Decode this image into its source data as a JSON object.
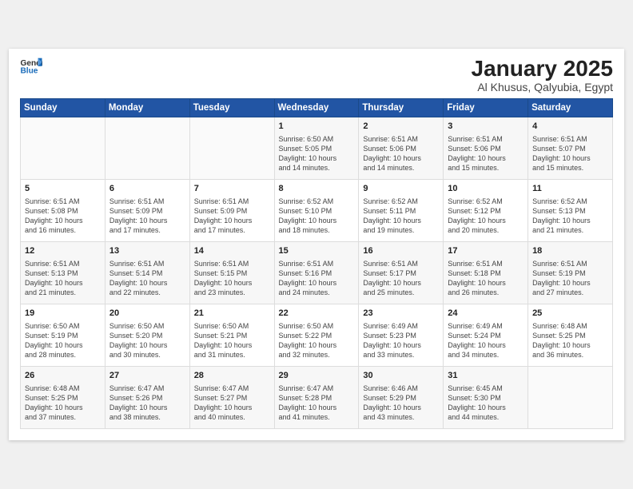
{
  "header": {
    "logo_general": "General",
    "logo_blue": "Blue",
    "month": "January 2025",
    "location": "Al Khusus, Qalyubia, Egypt"
  },
  "weekdays": [
    "Sunday",
    "Monday",
    "Tuesday",
    "Wednesday",
    "Thursday",
    "Friday",
    "Saturday"
  ],
  "rows": [
    [
      {
        "day": "",
        "info": ""
      },
      {
        "day": "",
        "info": ""
      },
      {
        "day": "",
        "info": ""
      },
      {
        "day": "1",
        "info": "Sunrise: 6:50 AM\nSunset: 5:05 PM\nDaylight: 10 hours\nand 14 minutes."
      },
      {
        "day": "2",
        "info": "Sunrise: 6:51 AM\nSunset: 5:06 PM\nDaylight: 10 hours\nand 14 minutes."
      },
      {
        "day": "3",
        "info": "Sunrise: 6:51 AM\nSunset: 5:06 PM\nDaylight: 10 hours\nand 15 minutes."
      },
      {
        "day": "4",
        "info": "Sunrise: 6:51 AM\nSunset: 5:07 PM\nDaylight: 10 hours\nand 15 minutes."
      }
    ],
    [
      {
        "day": "5",
        "info": "Sunrise: 6:51 AM\nSunset: 5:08 PM\nDaylight: 10 hours\nand 16 minutes."
      },
      {
        "day": "6",
        "info": "Sunrise: 6:51 AM\nSunset: 5:09 PM\nDaylight: 10 hours\nand 17 minutes."
      },
      {
        "day": "7",
        "info": "Sunrise: 6:51 AM\nSunset: 5:09 PM\nDaylight: 10 hours\nand 17 minutes."
      },
      {
        "day": "8",
        "info": "Sunrise: 6:52 AM\nSunset: 5:10 PM\nDaylight: 10 hours\nand 18 minutes."
      },
      {
        "day": "9",
        "info": "Sunrise: 6:52 AM\nSunset: 5:11 PM\nDaylight: 10 hours\nand 19 minutes."
      },
      {
        "day": "10",
        "info": "Sunrise: 6:52 AM\nSunset: 5:12 PM\nDaylight: 10 hours\nand 20 minutes."
      },
      {
        "day": "11",
        "info": "Sunrise: 6:52 AM\nSunset: 5:13 PM\nDaylight: 10 hours\nand 21 minutes."
      }
    ],
    [
      {
        "day": "12",
        "info": "Sunrise: 6:51 AM\nSunset: 5:13 PM\nDaylight: 10 hours\nand 21 minutes."
      },
      {
        "day": "13",
        "info": "Sunrise: 6:51 AM\nSunset: 5:14 PM\nDaylight: 10 hours\nand 22 minutes."
      },
      {
        "day": "14",
        "info": "Sunrise: 6:51 AM\nSunset: 5:15 PM\nDaylight: 10 hours\nand 23 minutes."
      },
      {
        "day": "15",
        "info": "Sunrise: 6:51 AM\nSunset: 5:16 PM\nDaylight: 10 hours\nand 24 minutes."
      },
      {
        "day": "16",
        "info": "Sunrise: 6:51 AM\nSunset: 5:17 PM\nDaylight: 10 hours\nand 25 minutes."
      },
      {
        "day": "17",
        "info": "Sunrise: 6:51 AM\nSunset: 5:18 PM\nDaylight: 10 hours\nand 26 minutes."
      },
      {
        "day": "18",
        "info": "Sunrise: 6:51 AM\nSunset: 5:19 PM\nDaylight: 10 hours\nand 27 minutes."
      }
    ],
    [
      {
        "day": "19",
        "info": "Sunrise: 6:50 AM\nSunset: 5:19 PM\nDaylight: 10 hours\nand 28 minutes."
      },
      {
        "day": "20",
        "info": "Sunrise: 6:50 AM\nSunset: 5:20 PM\nDaylight: 10 hours\nand 30 minutes."
      },
      {
        "day": "21",
        "info": "Sunrise: 6:50 AM\nSunset: 5:21 PM\nDaylight: 10 hours\nand 31 minutes."
      },
      {
        "day": "22",
        "info": "Sunrise: 6:50 AM\nSunset: 5:22 PM\nDaylight: 10 hours\nand 32 minutes."
      },
      {
        "day": "23",
        "info": "Sunrise: 6:49 AM\nSunset: 5:23 PM\nDaylight: 10 hours\nand 33 minutes."
      },
      {
        "day": "24",
        "info": "Sunrise: 6:49 AM\nSunset: 5:24 PM\nDaylight: 10 hours\nand 34 minutes."
      },
      {
        "day": "25",
        "info": "Sunrise: 6:48 AM\nSunset: 5:25 PM\nDaylight: 10 hours\nand 36 minutes."
      }
    ],
    [
      {
        "day": "26",
        "info": "Sunrise: 6:48 AM\nSunset: 5:25 PM\nDaylight: 10 hours\nand 37 minutes."
      },
      {
        "day": "27",
        "info": "Sunrise: 6:47 AM\nSunset: 5:26 PM\nDaylight: 10 hours\nand 38 minutes."
      },
      {
        "day": "28",
        "info": "Sunrise: 6:47 AM\nSunset: 5:27 PM\nDaylight: 10 hours\nand 40 minutes."
      },
      {
        "day": "29",
        "info": "Sunrise: 6:47 AM\nSunset: 5:28 PM\nDaylight: 10 hours\nand 41 minutes."
      },
      {
        "day": "30",
        "info": "Sunrise: 6:46 AM\nSunset: 5:29 PM\nDaylight: 10 hours\nand 43 minutes."
      },
      {
        "day": "31",
        "info": "Sunrise: 6:45 AM\nSunset: 5:30 PM\nDaylight: 10 hours\nand 44 minutes."
      },
      {
        "day": "",
        "info": ""
      }
    ]
  ]
}
